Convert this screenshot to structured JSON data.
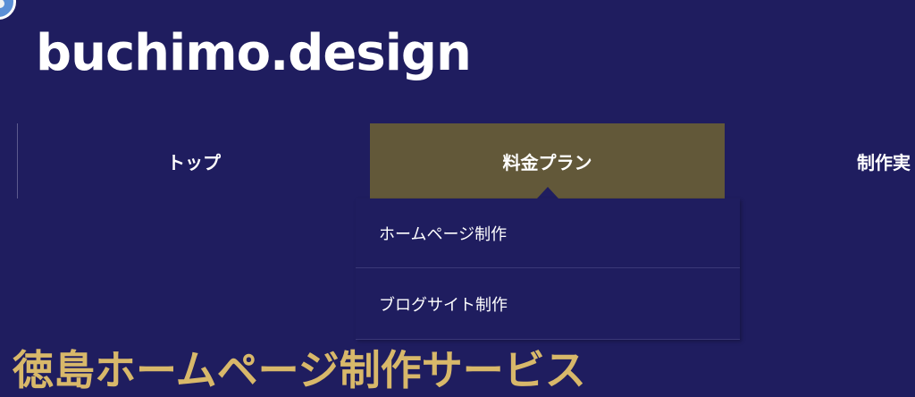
{
  "header": {
    "logo_icon": "logo-circle-icon",
    "site_title": "buchimo.design"
  },
  "nav": {
    "items": [
      {
        "label": "トップ"
      },
      {
        "label": "料金プラン",
        "active": true
      },
      {
        "label": "制作実"
      }
    ],
    "dropdown": [
      {
        "label": "ホームページ制作"
      },
      {
        "label": "ブログサイト制作"
      }
    ]
  },
  "hero": {
    "title": "徳島ホームページ制作サービス"
  },
  "colors": {
    "background": "#1f1d5f",
    "active_nav": "#625839",
    "hero_text": "#d8b86a",
    "text": "#ffffff"
  }
}
